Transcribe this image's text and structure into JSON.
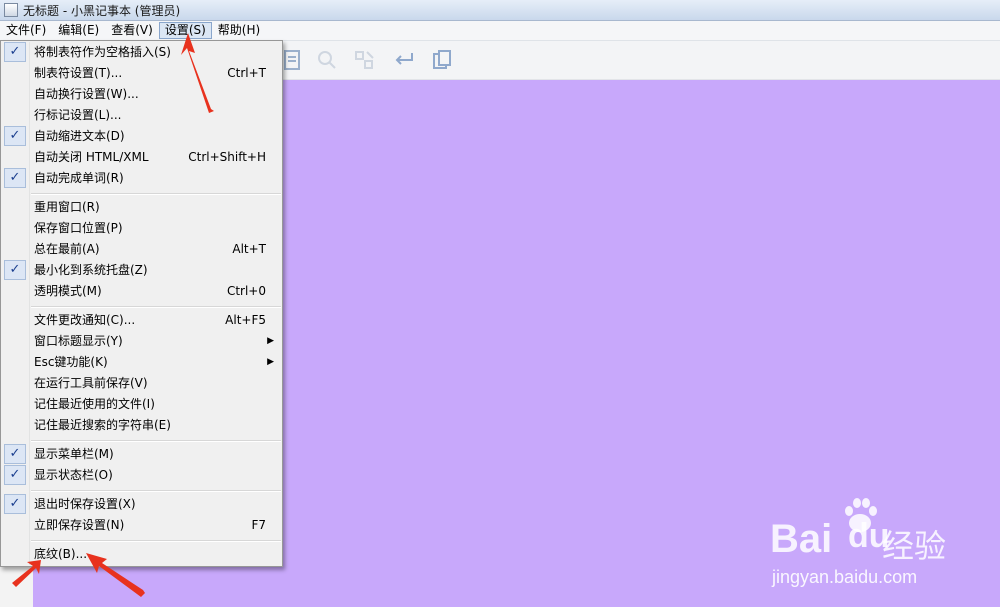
{
  "window": {
    "title": "无标题 - 小黑记事本 (管理员)"
  },
  "menubar": [
    {
      "label": "文件(F)"
    },
    {
      "label": "编辑(E)"
    },
    {
      "label": "查看(V)"
    },
    {
      "label": "设置(S)",
      "active": true
    },
    {
      "label": "帮助(H)"
    }
  ],
  "toolbar": {
    "icons": [
      "document-icon",
      "search-icon",
      "replace-icon",
      "wrap-icon",
      "cards-icon"
    ]
  },
  "settings_menu": {
    "items": [
      {
        "label": "将制表符作为空格插入(S)",
        "shortcut": "",
        "checked": true
      },
      {
        "label": "制表符设置(T)...",
        "shortcut": "Ctrl+T",
        "checked": false
      },
      {
        "label": "自动换行设置(W)...",
        "shortcut": "",
        "checked": false
      },
      {
        "label": "行标记设置(L)...",
        "shortcut": "",
        "checked": false
      },
      {
        "label": "自动缩进文本(D)",
        "shortcut": "",
        "checked": true
      },
      {
        "label": "自动关闭 HTML/XML",
        "shortcut": "Ctrl+Shift+H",
        "checked": false
      },
      {
        "label": "自动完成单词(R)",
        "shortcut": "",
        "checked": true
      },
      {
        "label": "重用窗口(R)",
        "shortcut": "",
        "checked": false
      },
      {
        "label": "保存窗口位置(P)",
        "shortcut": "",
        "checked": false
      },
      {
        "label": "总在最前(A)",
        "shortcut": "Alt+T",
        "checked": false
      },
      {
        "label": "最小化到系统托盘(Z)",
        "shortcut": "",
        "checked": true
      },
      {
        "label": "透明模式(M)",
        "shortcut": "Ctrl+0",
        "checked": false
      },
      {
        "label": "文件更改通知(C)...",
        "shortcut": "Alt+F5",
        "checked": false
      },
      {
        "label": "窗口标题显示(Y)",
        "shortcut": "",
        "checked": false,
        "submenu": true
      },
      {
        "label": "Esc键功能(K)",
        "shortcut": "",
        "checked": false,
        "submenu": true
      },
      {
        "label": "在运行工具前保存(V)",
        "shortcut": "",
        "checked": false
      },
      {
        "label": "记住最近使用的文件(I)",
        "shortcut": "",
        "checked": false
      },
      {
        "label": "记住最近搜索的字符串(E)",
        "shortcut": "",
        "checked": false
      },
      {
        "label": "显示菜单栏(M)",
        "shortcut": "",
        "checked": true
      },
      {
        "label": "显示状态栏(O)",
        "shortcut": "",
        "checked": true
      },
      {
        "label": "退出时保存设置(X)",
        "shortcut": "",
        "checked": true
      },
      {
        "label": "立即保存设置(N)",
        "shortcut": "F7",
        "checked": false
      },
      {
        "label": "底纹(B)...",
        "shortcut": "",
        "checked": false
      }
    ],
    "check_glyph": "✓",
    "submenu_glyph": "▶"
  },
  "editor": {
    "background": "#c8a8fb"
  },
  "annotation": {
    "color": "#e8321e"
  },
  "watermark": {
    "logo_latin": "Bai",
    "logo_du": "du",
    "logo_cn": "经验",
    "url": "jingyan.baidu.com"
  }
}
